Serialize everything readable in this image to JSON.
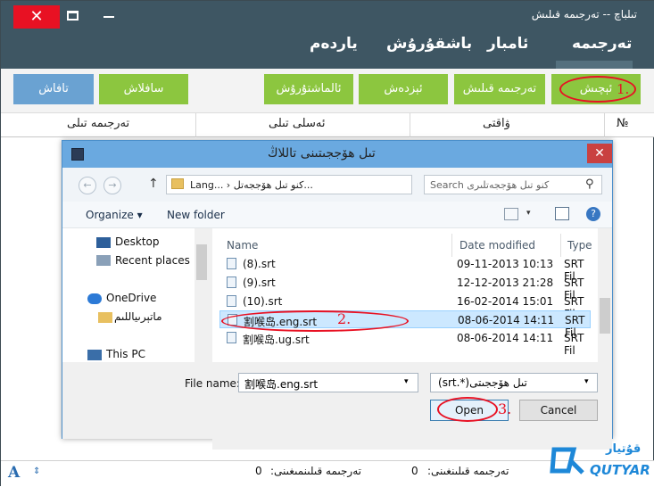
{
  "window": {
    "title": "تىلباچ -- تەرجىمە قىلىش",
    "close_glyph": "✕"
  },
  "menu": [
    "تەرجىمە",
    "ئامبار",
    "باشقۇرۇش",
    "ياردەم"
  ],
  "toolbar": {
    "open": "ئېچىش",
    "open_step": "1.",
    "translate": "تەرجىمە قىلىش",
    "save": "ئېزدەش",
    "replace": "ئالماشتۇرۇش",
    "compare": "سافلاش",
    "clear": "تافاش"
  },
  "table": {
    "headers": [
      "№",
      "ۋاقتى",
      "ئەسلى تىلى",
      "تەرجىمە تىلى"
    ]
  },
  "dialog": {
    "title": "تىل ھۆججىتىنى تاللاڭ",
    "address": "Lang... › كنو تىل ھۆججەتل...",
    "search_placeholder": "Search كنو تىل ھۆججەتلىرى",
    "organize": "Organize ▾",
    "new_folder": "New folder",
    "nav_items": [
      "Desktop",
      "Recent places",
      "OneDrive",
      "ماتېرىياللىم",
      "This PC"
    ],
    "columns": [
      "Name",
      "Date modified",
      "Type"
    ],
    "files": [
      {
        "name": "(8).srt",
        "date": "09-11-2013 10:13",
        "type": "SRT Fil"
      },
      {
        "name": "(9).srt",
        "date": "12-12-2013 21:28",
        "type": "SRT Fil"
      },
      {
        "name": "(10).srt",
        "date": "16-02-2014 15:01",
        "type": "SRT Fil"
      },
      {
        "name": "割喉岛.eng.srt",
        "date": "08-06-2014 14:11",
        "type": "SRT Fil"
      },
      {
        "name": "割喉岛.ug.srt",
        "date": "08-06-2014 14:11",
        "type": "SRT Fil"
      }
    ],
    "selected_index": 3,
    "step2": "2.",
    "file_name_label": "File name:",
    "file_name_value": "割喉岛.eng.srt",
    "file_type": "تىل ھۆججىتى(*.srt)",
    "open_button": "Open",
    "cancel_button": "Cancel",
    "step3": "3."
  },
  "status": {
    "translated_label": "تەرجىمە قىلىنغىنى:",
    "translated_value": "0",
    "untranslated_label": "تەرجىمە قىلىنمىغىنى:",
    "untranslated_value": "0"
  },
  "logo": {
    "text": "QUTYAR",
    "ug": "قۇتيار"
  },
  "colors": {
    "topbar": "#3e5663",
    "green": "#8cc63f",
    "blue": "#6aa2d2",
    "dialog_title": "#6aa9e0",
    "annotation": "#e81123"
  }
}
